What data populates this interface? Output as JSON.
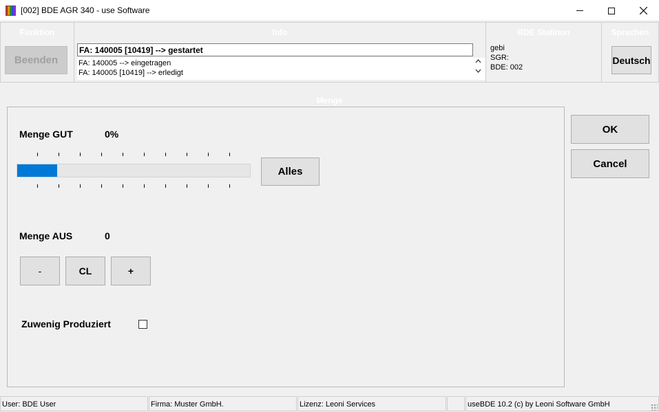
{
  "window": {
    "title": "[002] BDE AGR 340 - use Software",
    "min_icon": "minimize-icon",
    "max_icon": "maximize-icon",
    "close_icon": "close-icon"
  },
  "header": {
    "funktion": {
      "title": "Funktion",
      "button_label": "Beenden",
      "button_enabled": false
    },
    "info": {
      "title": "Info",
      "current": "FA: 140005 [10419] --> gestartet",
      "log": [
        "FA: 140005 --> eingetragen",
        "FA: 140005 [10419] --> erledigt"
      ],
      "scroll_up_icon": "chevron-up-icon",
      "scroll_down_icon": "chevron-down-icon"
    },
    "station": {
      "title": "BDE Statinon",
      "lines": [
        "gebi",
        "SGR:",
        "BDE: 002"
      ]
    },
    "sprachen": {
      "title": "Sprachen",
      "button_label": "Deutsch"
    }
  },
  "menge": {
    "title": "Menge",
    "gut": {
      "label": "Menge GUT",
      "value": "0%",
      "slider_fraction": 0.0
    },
    "alles_label": "Alles",
    "aus": {
      "label": "Menge AUS",
      "value": "0"
    },
    "minus_label": "-",
    "cl_label": "CL",
    "plus_label": "+",
    "zuwenig_label": "Zuwenig Produziert",
    "zuwenig_checked": false
  },
  "dialog": {
    "ok_label": "OK",
    "cancel_label": "Cancel"
  },
  "colors": {
    "accent": "#0078d7",
    "panel_title": "#ffffff",
    "background": "#f0f0f0"
  },
  "statusbar": {
    "user": "User: BDE User",
    "firma": "Firma: Muster GmbH.",
    "lizenz": "Lizenz: Leoni Services",
    "empty": "",
    "version": "useBDE 10.2 (c) by Leoni Software GmbH"
  }
}
